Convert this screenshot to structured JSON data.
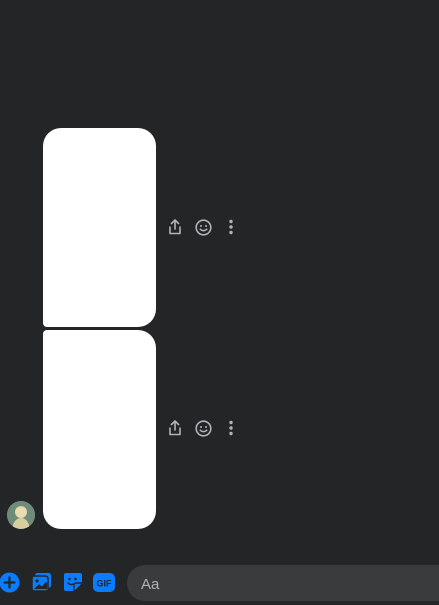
{
  "messages": [
    {
      "id": "bubble-1",
      "type": "sticker",
      "background": "#ffffff"
    },
    {
      "id": "bubble-2",
      "type": "sticker",
      "background": "#ffffff"
    }
  ],
  "message_actions": [
    "share-icon",
    "emoji-reaction-icon",
    "more-options-icon"
  ],
  "composer": {
    "tools": [
      "add-icon",
      "photo-icon",
      "sticker-icon",
      "gif-icon"
    ],
    "gif_label": "GIF",
    "input_placeholder": "Aa"
  },
  "colors": {
    "background": "#242526",
    "accent": "#0a7cff",
    "icon": "#b0b3b8",
    "input_bg": "#3a3b3c"
  }
}
